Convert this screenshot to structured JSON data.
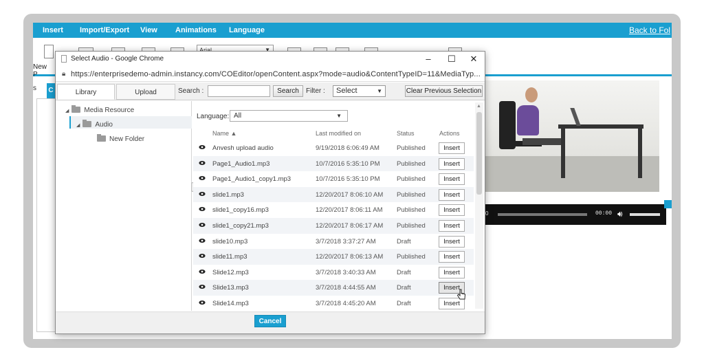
{
  "menu": {
    "items": [
      {
        "label": "Insert"
      },
      {
        "label": "Import/Export"
      },
      {
        "label": "View"
      },
      {
        "label": "Animations"
      },
      {
        "label": "Language"
      }
    ],
    "back_link": "Back to Fol"
  },
  "toolbar": {
    "new_page_label": "New P",
    "font_value": "Arial"
  },
  "side": {
    "tab_s": "s",
    "tab_c": "C"
  },
  "player": {
    "start_time": "0",
    "time": "00:00"
  },
  "dialog": {
    "title": "Select Audio - Google Chrome",
    "window_controls": {
      "minimize": "–",
      "maximize": "☐",
      "close": "✕"
    },
    "url": "https://enterprisedemo-admin.instancy.com/COEditor/openContent.aspx?mode=audio&ContentTypeID=11&MediaTyp...",
    "tabs": [
      {
        "label": "Library",
        "active": true
      },
      {
        "label": "Upload",
        "active": false
      }
    ],
    "search_label": "Search :",
    "search_value": "",
    "search_button": "Search",
    "filter_label": "Filter :",
    "filter_value": "Select",
    "clear_button": "Clear Previous Selection",
    "tree": [
      {
        "label": "Media Resource"
      },
      {
        "label": "Audio"
      },
      {
        "label": "New Folder"
      }
    ],
    "language_label": "Language:",
    "language_value": "All",
    "columns": {
      "name": "Name",
      "modified": "Last modified on",
      "status": "Status",
      "actions": "Actions"
    },
    "rows": [
      {
        "name": "Anvesh upload audio",
        "date": "9/19/2018 6:06:49 AM",
        "status": "Published",
        "action": "Insert"
      },
      {
        "name": "Page1_Audio1.mp3",
        "date": "10/7/2016 5:35:10 PM",
        "status": "Published",
        "action": "Insert"
      },
      {
        "name": "Page1_Audio1_copy1.mp3",
        "date": "10/7/2016 5:35:10 PM",
        "status": "Published",
        "action": "Insert"
      },
      {
        "name": "slide1.mp3",
        "date": "12/20/2017 8:06:10 AM",
        "status": "Published",
        "action": "Insert"
      },
      {
        "name": "slide1_copy16.mp3",
        "date": "12/20/2017 8:06:11 AM",
        "status": "Published",
        "action": "Insert"
      },
      {
        "name": "slide1_copy21.mp3",
        "date": "12/20/2017 8:06:17 AM",
        "status": "Published",
        "action": "Insert"
      },
      {
        "name": "slide10.mp3",
        "date": "3/7/2018 3:37:27 AM",
        "status": "Draft",
        "action": "Insert"
      },
      {
        "name": "slide11.mp3",
        "date": "12/20/2017 8:06:13 AM",
        "status": "Published",
        "action": "Insert"
      },
      {
        "name": "Slide12.mp3",
        "date": "3/7/2018 3:40:33 AM",
        "status": "Draft",
        "action": "Insert"
      },
      {
        "name": "Slide13.mp3",
        "date": "3/7/2018 4:44:55 AM",
        "status": "Draft",
        "action": "Insert"
      },
      {
        "name": "Slide14.mp3",
        "date": "3/7/2018 4:45:20 AM",
        "status": "Draft",
        "action": "Insert"
      }
    ],
    "cancel_button": "Cancel"
  },
  "colors": {
    "accent": "#1a9fd0",
    "frame": "#c8c8c8"
  }
}
